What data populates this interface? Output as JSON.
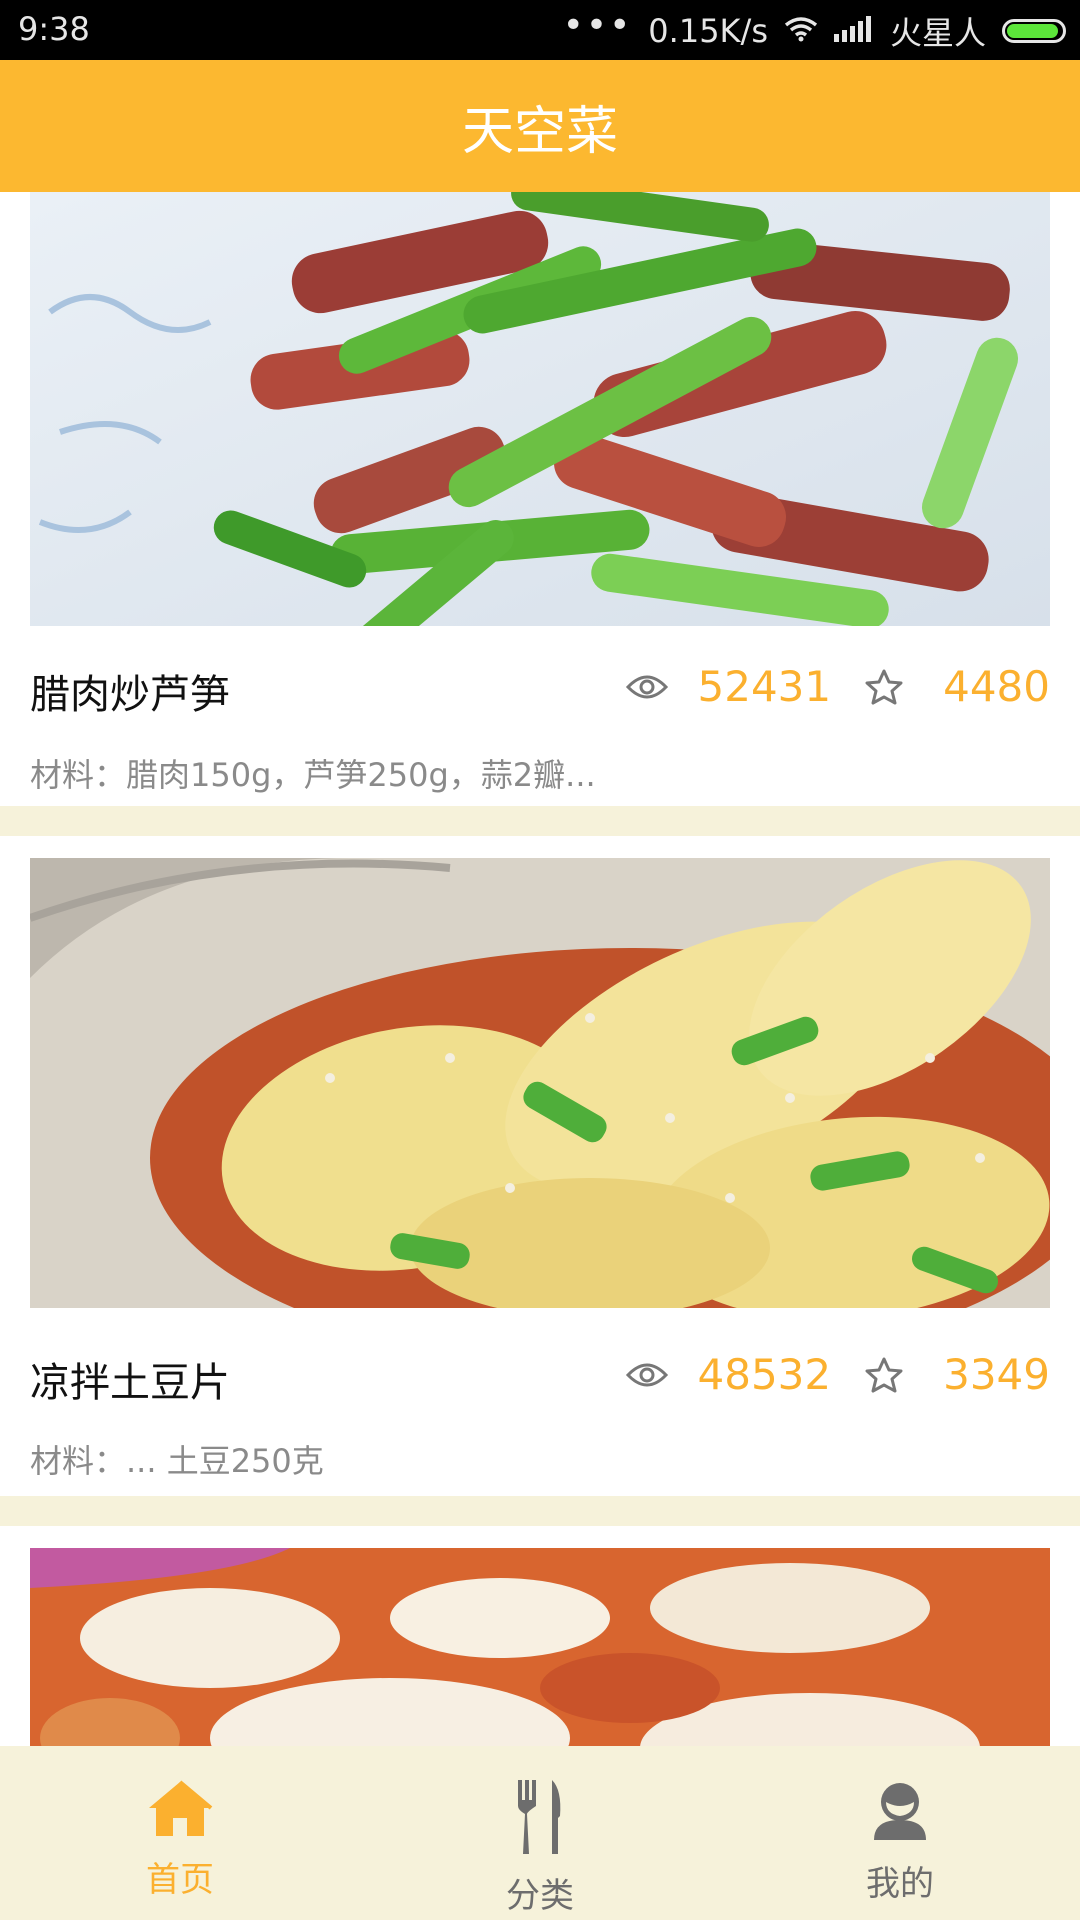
{
  "status_bar": {
    "time": "9:38",
    "network_speed": "0.15K/s",
    "carrier": "火星人",
    "battery_level": 0.95
  },
  "header": {
    "title": "天空菜"
  },
  "recipes": [
    {
      "title": "腊肉炒芦笋",
      "views": "52431",
      "favorites": "4480",
      "description": "材料：腊肉150g，芦笋250g，蒜2瓣..."
    },
    {
      "title": "凉拌土豆片",
      "views": "48532",
      "favorites": "3349",
      "description": "材料：... 土豆250克"
    },
    {
      "title": "",
      "views": "",
      "favorites": "",
      "description": ""
    }
  ],
  "tabbar": {
    "home": "首页",
    "category": "分类",
    "mine": "我的"
  },
  "colors": {
    "accent": "#fcb830",
    "number_orange": "#fbb02f",
    "background": "#f6f2da",
    "inactive_tab": "#6d6d6d"
  },
  "icons": [
    "home-icon",
    "fork-knife-icon",
    "user-icon",
    "eye-icon",
    "star-icon",
    "wifi-icon",
    "signal-icon",
    "battery-icon"
  ]
}
